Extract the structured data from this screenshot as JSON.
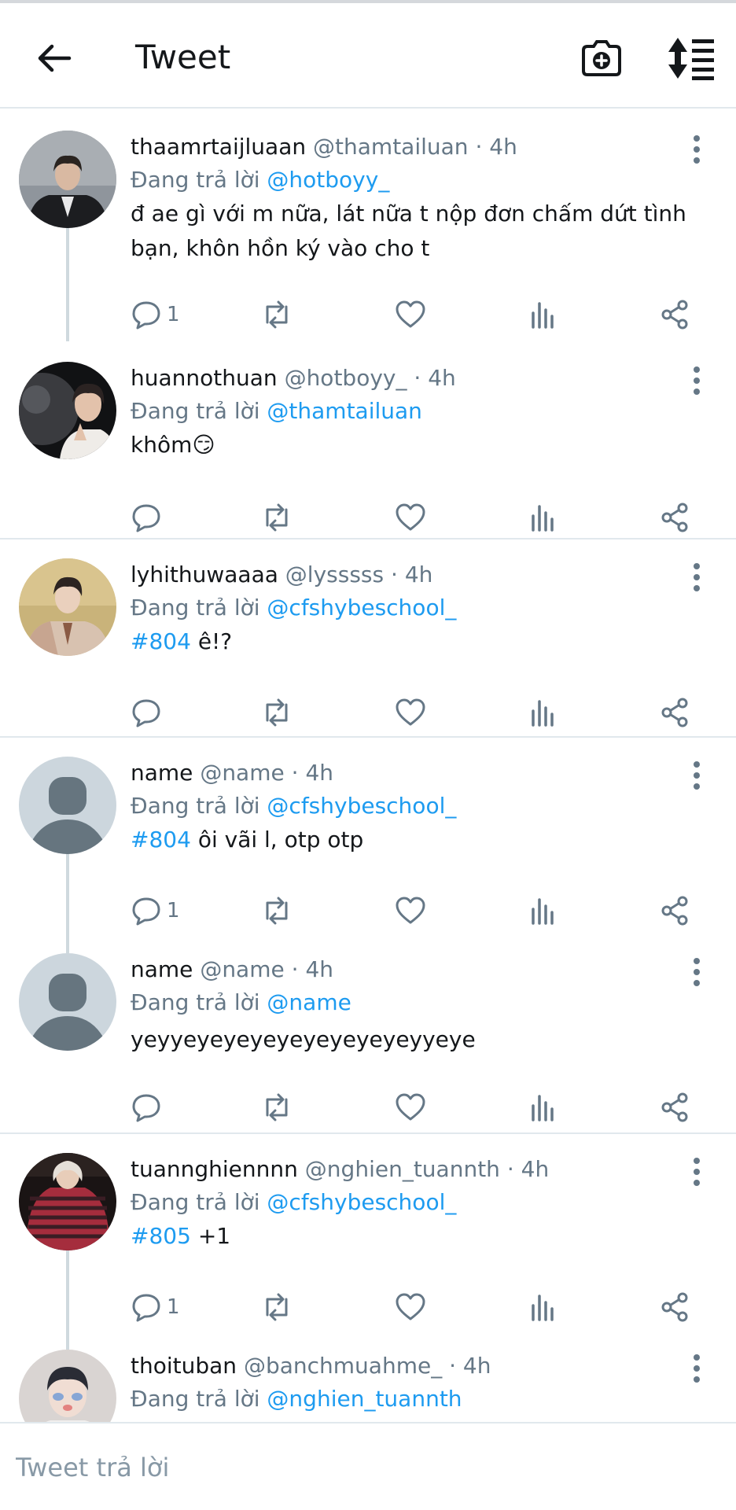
{
  "header": {
    "title": "Tweet",
    "back_icon": "arrow-left-icon",
    "camera_icon": "camera-plus-icon",
    "sort_icon": "sort-icon"
  },
  "colors": {
    "accent": "#1d9bf0",
    "secondary_text": "#657786",
    "divider": "#e1e8ed",
    "thread_line": "#cfd9de"
  },
  "tweets": [
    {
      "name": "thaamrtaijluaan",
      "handle": "@thamtailuan",
      "time": "4h",
      "replying_prefix": "Đang trả lời",
      "replying_to": "@hotboyy_",
      "hashtag": "",
      "text": "đ ae gì với m nữa, lát nữa t nộp đơn chấm dứt tình bạn, khôn hồn ký vào cho t",
      "reply_count": "1"
    },
    {
      "name": "huannothuan",
      "handle": "@hotboyy_",
      "time": "4h",
      "replying_prefix": "Đang trả lời",
      "replying_to": "@thamtailuan",
      "hashtag": "",
      "text": "khôm😏",
      "reply_count": ""
    },
    {
      "name": "lyhithuwaaaa",
      "handle": "@lysssss",
      "time": "4h",
      "replying_prefix": "Đang trả lời",
      "replying_to": "@cfshybeschool_",
      "hashtag": "#804",
      "text": "ê!?",
      "reply_count": ""
    },
    {
      "name": "name",
      "handle": "@name",
      "time": "4h",
      "replying_prefix": "Đang trả lời",
      "replying_to": "@cfshybeschool_",
      "hashtag": "#804",
      "text": "ôi vãi l, otp otp",
      "reply_count": "1"
    },
    {
      "name": "name",
      "handle": "@name",
      "time": "4h",
      "replying_prefix": "Đang trả lời",
      "replying_to": "@name",
      "hashtag": "",
      "text": "yeyyeyeyeyeyeyeyeyeyeyyeye",
      "reply_count": ""
    },
    {
      "name": "tuannghiennnn",
      "handle": "@nghien_tuannth",
      "time": "4h",
      "replying_prefix": "Đang trả lời",
      "replying_to": "@cfshybeschool_",
      "hashtag": "#805",
      "text": "+1",
      "reply_count": "1"
    },
    {
      "name": "thoituban",
      "handle": "@banchmuahme_",
      "time": "4h",
      "replying_prefix": "Đang trả lời",
      "replying_to": "@nghien_tuannth",
      "hashtag": "",
      "text": "",
      "reply_count": ""
    }
  ],
  "action_icons": [
    "reply-icon",
    "retweet-icon",
    "like-icon",
    "stats-icon",
    "share-icon"
  ],
  "reply_bar": {
    "placeholder": "Tweet trả lời"
  }
}
